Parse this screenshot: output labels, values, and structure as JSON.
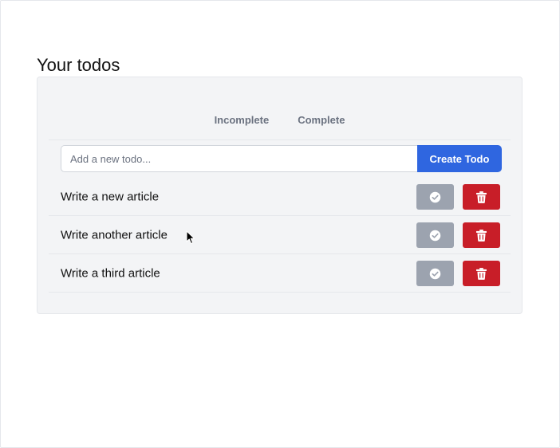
{
  "page": {
    "title": "Your todos"
  },
  "tabs": [
    {
      "label": "Incomplete"
    },
    {
      "label": "Complete"
    }
  ],
  "new_todo": {
    "placeholder": "Add a new todo...",
    "value": "",
    "create_label": "Create Todo"
  },
  "todos": [
    {
      "text": "Write a new article"
    },
    {
      "text": "Write another article"
    },
    {
      "text": "Write a third article"
    }
  ],
  "colors": {
    "accent": "#2f66e0",
    "complete_button": "#9ca3af",
    "delete_button": "#c81e28",
    "card_bg": "#f3f4f6"
  },
  "icons": {
    "complete": "check-circle-icon",
    "delete": "trash-icon",
    "cursor": "mouse-pointer-icon"
  }
}
